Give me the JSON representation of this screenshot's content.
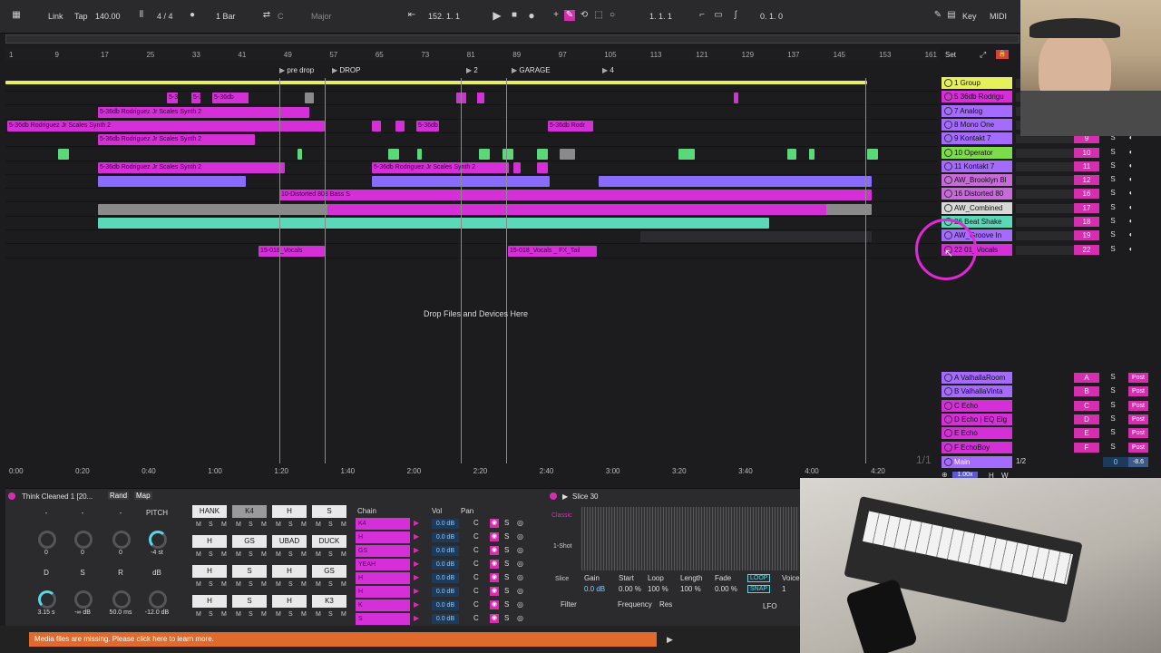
{
  "transport": {
    "link": "Link",
    "tap": "Tap",
    "tempo": "140.00",
    "time_sig": "4 / 4",
    "quantize": "1 Bar",
    "key_root": "C",
    "scale": "Major",
    "position": "152.   1.   1",
    "loop_start": "1.   1.   1",
    "loop_length": "0.   1.   0",
    "key_label": "Key",
    "midi_label": "MIDI"
  },
  "ruler_ticks": [
    "1",
    "9",
    "17",
    "25",
    "33",
    "41",
    "49",
    "57",
    "65",
    "73",
    "81",
    "89",
    "97",
    "105",
    "113",
    "121",
    "129",
    "137",
    "145",
    "153",
    "161"
  ],
  "locators": [
    "pre drop",
    "DROP",
    "2",
    "GARAGE",
    "4"
  ],
  "time_ticks": [
    "0:00",
    "0:20",
    "0:40",
    "1:00",
    "1:20",
    "1:40",
    "2:00",
    "2:20",
    "2:40",
    "3:00",
    "3:20",
    "3:40",
    "4:00",
    "4:20"
  ],
  "drop_hint": "Drop Files and Devices Here",
  "page_indicator": "1/1",
  "clip_labels": {
    "synth2": "5-36db Rodriguez Jr Scales Synth 2",
    "short": "5-36db",
    "rodr": "5-36db Rodr",
    "distorted": "10-Distorted 808 Bass S",
    "vocals": "15-018_Vocals",
    "fx_tail": "15-018_Vocals _ FX_Tail"
  },
  "mixer": {
    "set_label": "Set",
    "tracks": [
      {
        "name": "1 Group",
        "num": "",
        "color": "#e6f05a"
      },
      {
        "name": "5 36db Rodrigu",
        "num": "",
        "color": "#d52fd8"
      },
      {
        "name": "7 Analog",
        "num": "",
        "color": "#a56bff"
      },
      {
        "name": "8 Mono One",
        "num": "",
        "color": "#a56bff"
      },
      {
        "name": "9 Kontakt 7",
        "num": "9",
        "color": "#a56bff"
      },
      {
        "name": "10 Operator",
        "num": "10",
        "color": "#7ddc4a"
      },
      {
        "name": "11 Kontakt 7",
        "num": "11",
        "color": "#a56bff"
      },
      {
        "name": "AW_Brooklyn Bl",
        "num": "12",
        "color": "#c66bd8"
      },
      {
        "name": "16 Distorted 80",
        "num": "16",
        "color": "#c66bd8"
      },
      {
        "name": "AW_Combined",
        "num": "17",
        "color": "#d8d8d8"
      },
      {
        "name": "26 Beat Shake",
        "num": "18",
        "color": "#5ad8b8"
      },
      {
        "name": "AW_Groove In",
        "num": "19",
        "color": "#a56bff"
      },
      {
        "name": "22 01_Vocals",
        "num": "22",
        "color": "#d52fd8"
      }
    ],
    "returns": [
      {
        "name": "A ValhallaRoom",
        "num": "A",
        "color": "#a56bff"
      },
      {
        "name": "B ValhallaVinta",
        "num": "B",
        "color": "#a56bff"
      },
      {
        "name": "C Echo",
        "num": "C",
        "color": "#d52fd8"
      },
      {
        "name": "D Echo | EQ Eig",
        "num": "D",
        "color": "#d52fd8"
      },
      {
        "name": "E Echo",
        "num": "E",
        "color": "#d52fd8"
      },
      {
        "name": "F EchoBoy",
        "num": "F",
        "color": "#d52fd8"
      }
    ],
    "main_label": "Main",
    "main_io": "1/2",
    "main_vol": "0",
    "main_db": "-8.6",
    "zoom": "1.00x",
    "solo": "S",
    "post": "Post",
    "h_label": "H",
    "w_label": "W"
  },
  "device": {
    "rack_title": "Think Cleaned 1 [20...",
    "rand": "Rand",
    "map": "Map",
    "macro_labels": [
      "-",
      "-",
      "-",
      "PITCH",
      "D",
      "S",
      "R",
      "dB"
    ],
    "macro_values": [
      "0",
      "0",
      "0",
      "-4 st",
      "3.15 s",
      "-∞ dB",
      "50.0 ms",
      "-12.0 dB"
    ],
    "pad_names": [
      "HANK",
      "K4",
      "H",
      "S",
      "H",
      "GS",
      "UBAD",
      "DUCK",
      "H",
      "S",
      "H",
      "GS",
      "H",
      "S",
      "H",
      "K3"
    ],
    "pad_btns": [
      "M",
      "S",
      "M"
    ],
    "chain_header": "Chain",
    "vol_header": "Vol",
    "pan_header": "Pan",
    "chains": [
      {
        "name": "K4",
        "vol": "0.0 dB",
        "pan": "C"
      },
      {
        "name": "H",
        "vol": "0.0 dB",
        "pan": "C"
      },
      {
        "name": "GS",
        "vol": "0.0 dB",
        "pan": "C"
      },
      {
        "name": "YEAH",
        "vol": "0.0 dB",
        "pan": "C"
      },
      {
        "name": "H",
        "vol": "0.0 dB",
        "pan": "C"
      },
      {
        "name": "H",
        "vol": "0.0 dB",
        "pan": "C"
      },
      {
        "name": "K",
        "vol": "0.0 dB",
        "pan": "C"
      },
      {
        "name": "S",
        "vol": "0.0 dB",
        "pan": "C"
      }
    ],
    "simpler_title": "Slice 30",
    "mode_classic": "Classic",
    "mode_oneshot": "1-Shot",
    "mode_slice": "Slice",
    "params": [
      "Gain",
      "Start",
      "Loop",
      "Length",
      "Fade",
      "LOOP",
      "Voice"
    ],
    "param_values": [
      "0.0 dB",
      "0.00 %",
      "100 %",
      "100 %",
      "0.00 %",
      "SNAP",
      "1"
    ],
    "filter": "Filter",
    "frequency": "Frequency",
    "res": "Res",
    "lfo": "LFO"
  },
  "status_message": "Media files are missing. Please click here to learn more."
}
